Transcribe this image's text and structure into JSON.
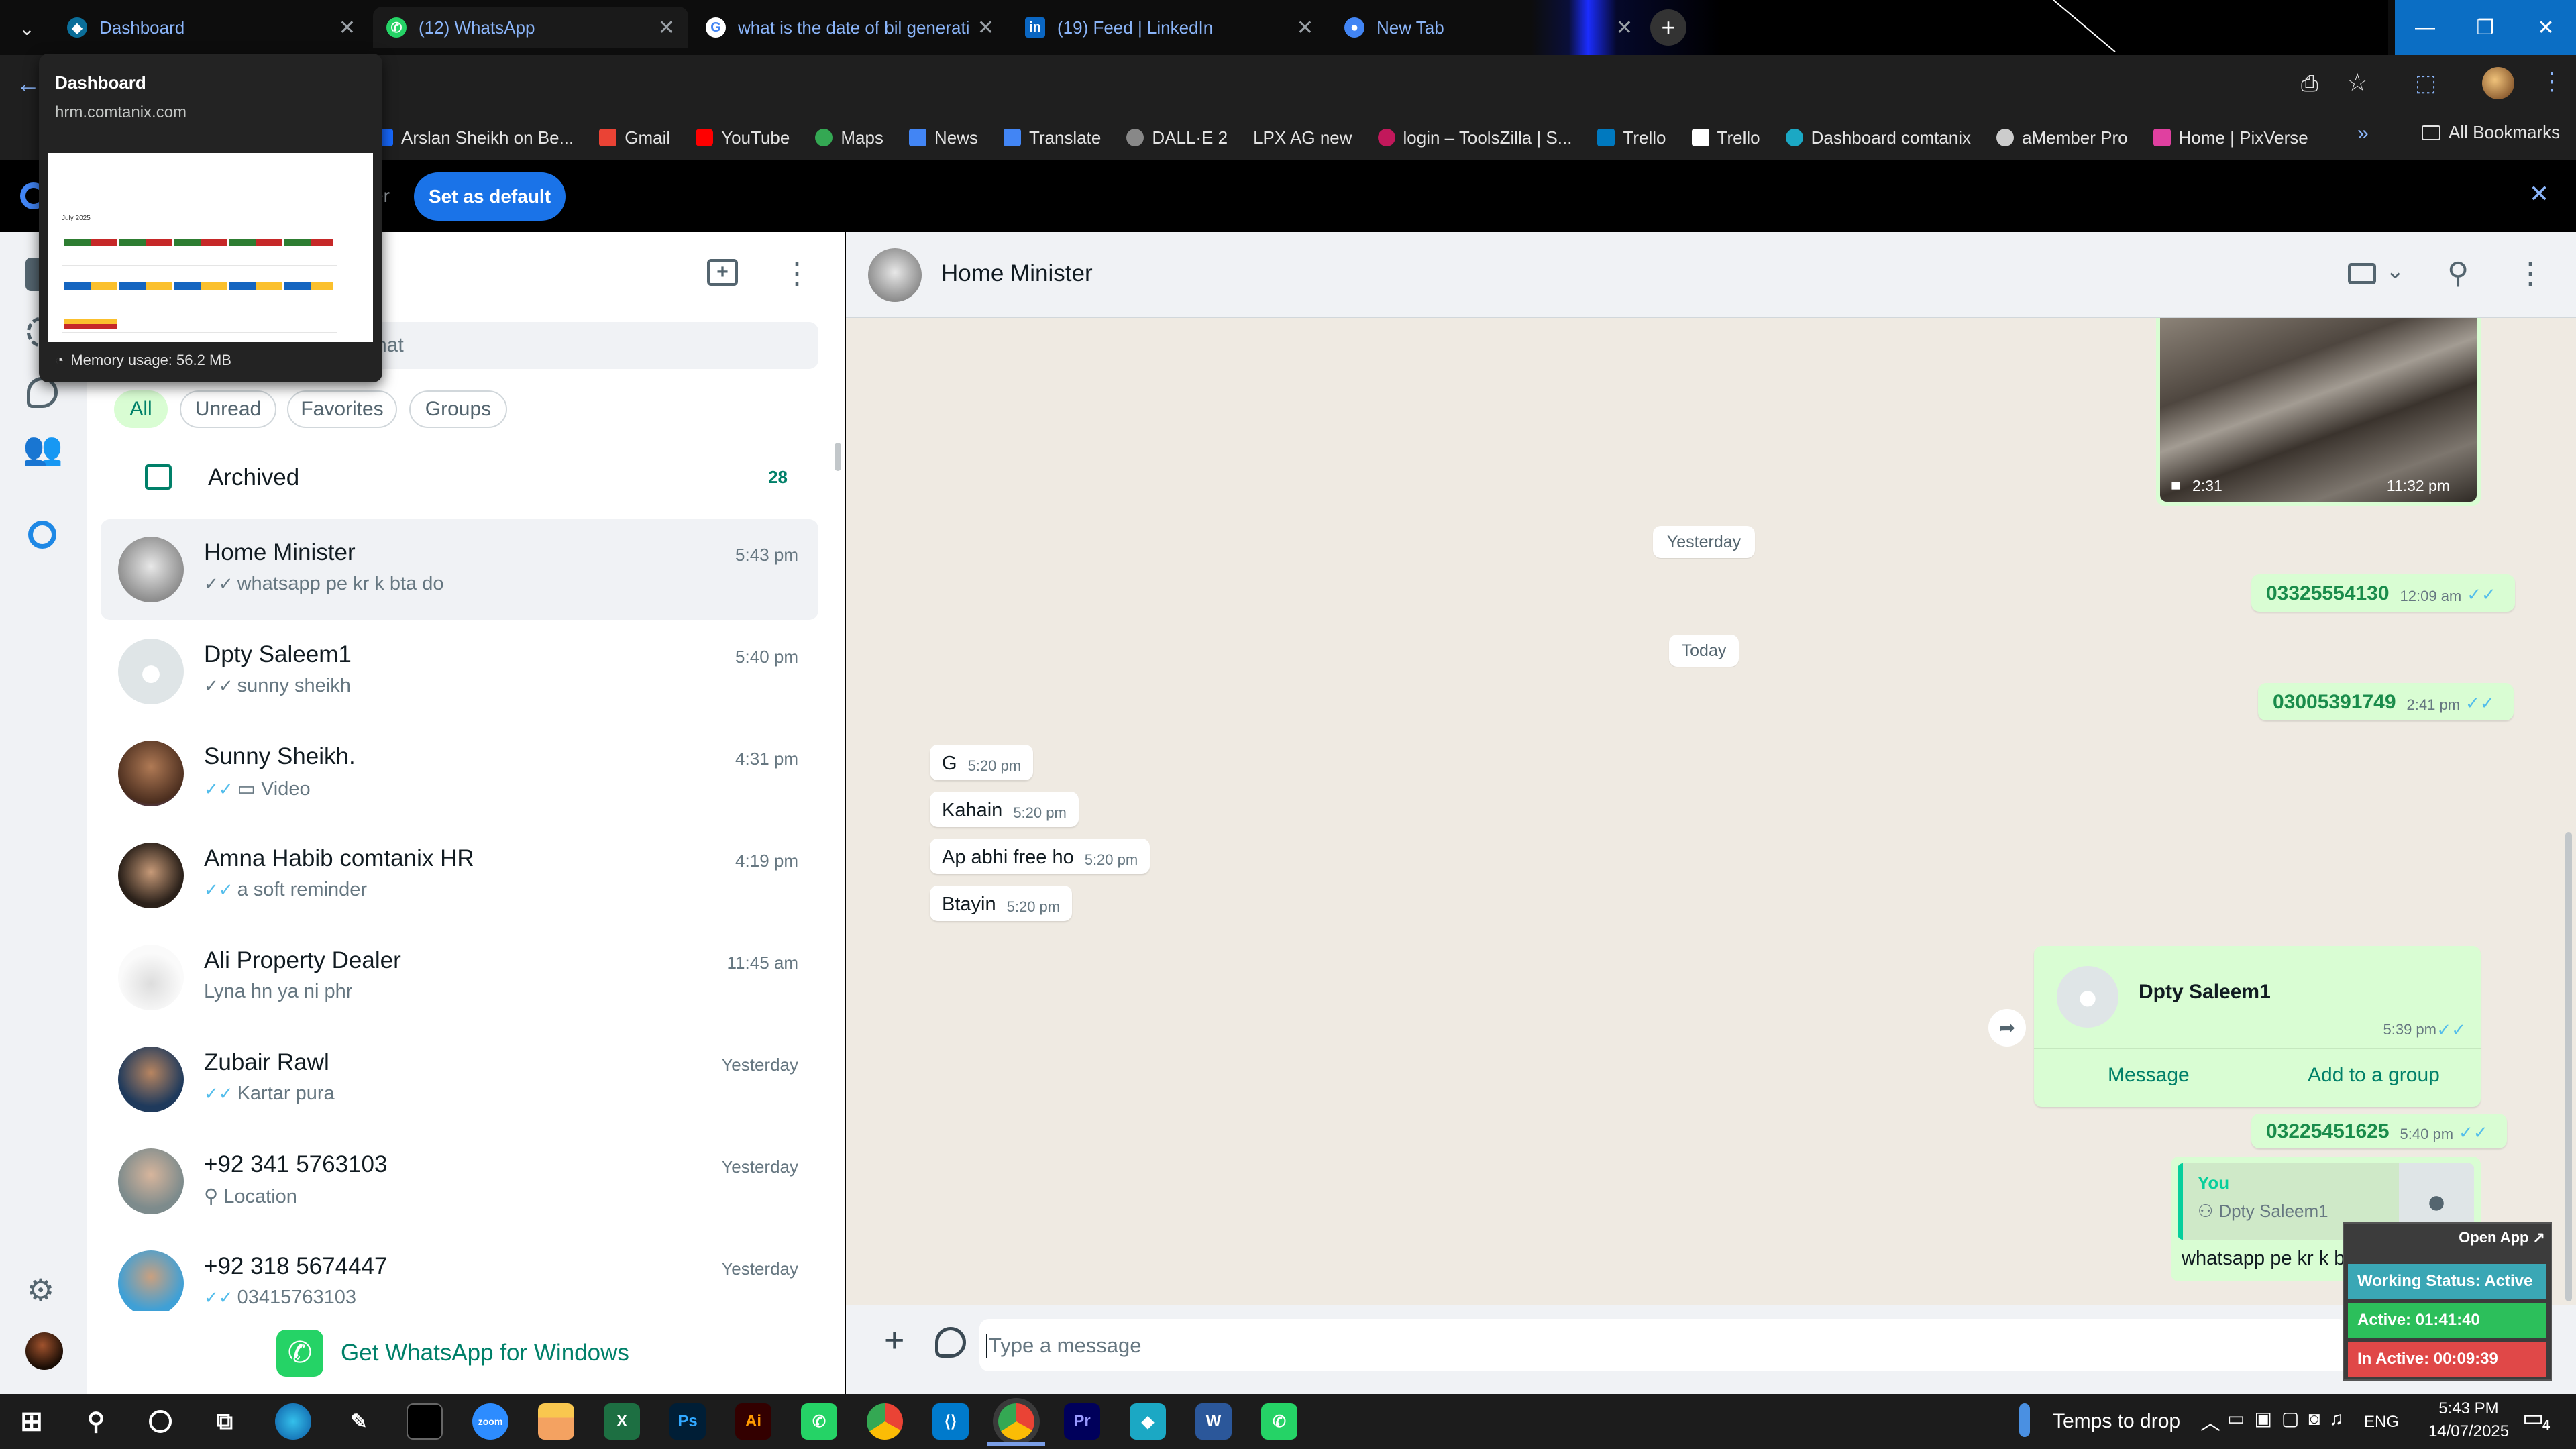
{
  "browser": {
    "tabs": [
      {
        "title": "Dashboard",
        "active": false
      },
      {
        "title": "(12) WhatsApp",
        "active": true
      },
      {
        "title": "what is the date of bil generati",
        "active": false
      },
      {
        "title": "(19) Feed | LinkedIn",
        "active": false
      },
      {
        "title": "New Tab",
        "active": false
      }
    ],
    "bookmarks": [
      "Arslan Sheikh on Be...",
      "Gmail",
      "YouTube",
      "Maps",
      "News",
      "Translate",
      "DALL·E 2",
      "LPX AG new",
      "login – ToolsZilla | S...",
      "Trello",
      "Trello",
      "Dashboard comtanix",
      "aMember Pro",
      "Home | PixVerse"
    ],
    "all_bookmarks": "All Bookmarks",
    "infobar": {
      "partial": "er",
      "button": "Set as default"
    },
    "hovercard": {
      "title": "Dashboard",
      "url": "hrm.comtanix.com",
      "thumb_caption": "July 2025",
      "memory": "Memory usage: 56.2 MB"
    }
  },
  "whatsapp": {
    "search_placeholder_partial": "hat",
    "filters": [
      "All",
      "Unread",
      "Favorites",
      "Groups"
    ],
    "archived": {
      "label": "Archived",
      "count": "28"
    },
    "chats": [
      {
        "name": "Home Minister",
        "preview": "whatsapp pe kr k bta do",
        "time": "5:43 pm",
        "tick": "grey"
      },
      {
        "name": "Dpty Saleem1",
        "preview": "sunny sheikh",
        "time": "5:40 pm",
        "tick": "grey"
      },
      {
        "name": "Sunny Sheikh.",
        "preview": "Video",
        "time": "4:31 pm",
        "tick": "blue"
      },
      {
        "name": "Amna Habib comtanix HR",
        "preview": "a soft reminder",
        "time": "4:19 pm",
        "tick": "blue"
      },
      {
        "name": "Ali Property Dealer",
        "preview": "Lyna hn ya ni phr",
        "time": "11:45 am",
        "tick": "none"
      },
      {
        "name": "Zubair Rawl",
        "preview": "Kartar pura",
        "time": "Yesterday",
        "tick": "blue"
      },
      {
        "name": "+92 341 5763103",
        "preview": "Location",
        "time": "Yesterday",
        "tick": "none"
      },
      {
        "name": "+92 318 5674447",
        "preview": "03415763103",
        "time": "Yesterday",
        "tick": "blue"
      }
    ],
    "get_app": "Get WhatsApp for Windows",
    "conversation": {
      "contact": "Home Minister",
      "video": {
        "duration": "2:31",
        "time": "11:32 pm"
      },
      "date_yesterday": "Yesterday",
      "date_today": "Today",
      "msgs": [
        {
          "text": "03325554130",
          "time": "12:09 am"
        },
        {
          "text": "03005391749",
          "time": "2:41 pm"
        }
      ],
      "incoming": [
        {
          "text": "G",
          "time": "5:20 pm"
        },
        {
          "text": "Kahain",
          "time": "5:20 pm"
        },
        {
          "text": "Ap abhi free ho",
          "time": "5:20 pm"
        },
        {
          "text": "Btayin",
          "time": "5:20 pm"
        }
      ],
      "contact_card": {
        "name": "Dpty Saleem1",
        "time": "5:39 pm",
        "action1": "Message",
        "action2": "Add to a group"
      },
      "msg3": {
        "text": "03225451625",
        "time": "5:40 pm"
      },
      "reply": {
        "author": "You",
        "quoted": "Dpty Saleem1",
        "text": "whatsapp pe kr k bta do"
      },
      "composer_placeholder": "Type a message"
    }
  },
  "status_widget": {
    "open_app": "Open App ↗",
    "working": "Working Status: Active",
    "active": "Active: 01:41:40",
    "inactive": "In Active: 00:09:39"
  },
  "taskbar": {
    "drop_text": "Temps to drop",
    "lang": "ENG",
    "time": "5:43 PM",
    "date": "14/07/2025",
    "notif_count": "4"
  },
  "colors": {
    "accent": "#008069",
    "bubble_out": "#d9fdd3",
    "tick_blue": "#53bdeb",
    "chrome_blue": "#1a73e8"
  }
}
